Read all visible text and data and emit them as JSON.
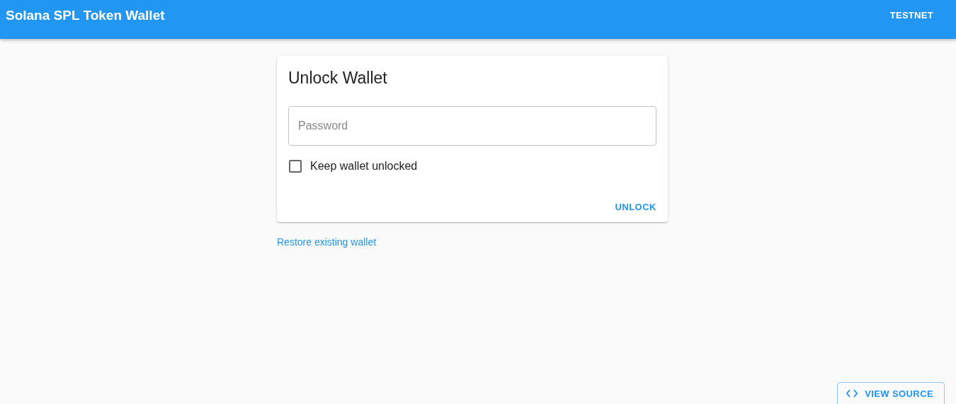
{
  "app_bar": {
    "title": "Solana SPL Token Wallet",
    "network_button": "TESTNET"
  },
  "unlock_card": {
    "title": "Unlock Wallet",
    "password": {
      "placeholder": "Password"
    },
    "keep_unlocked": {
      "label": "Keep wallet unlocked",
      "checked": false
    },
    "unlock_button": "UNLOCK"
  },
  "restore_link": "Restore existing wallet",
  "view_source_button": "VIEW SOURCE"
}
